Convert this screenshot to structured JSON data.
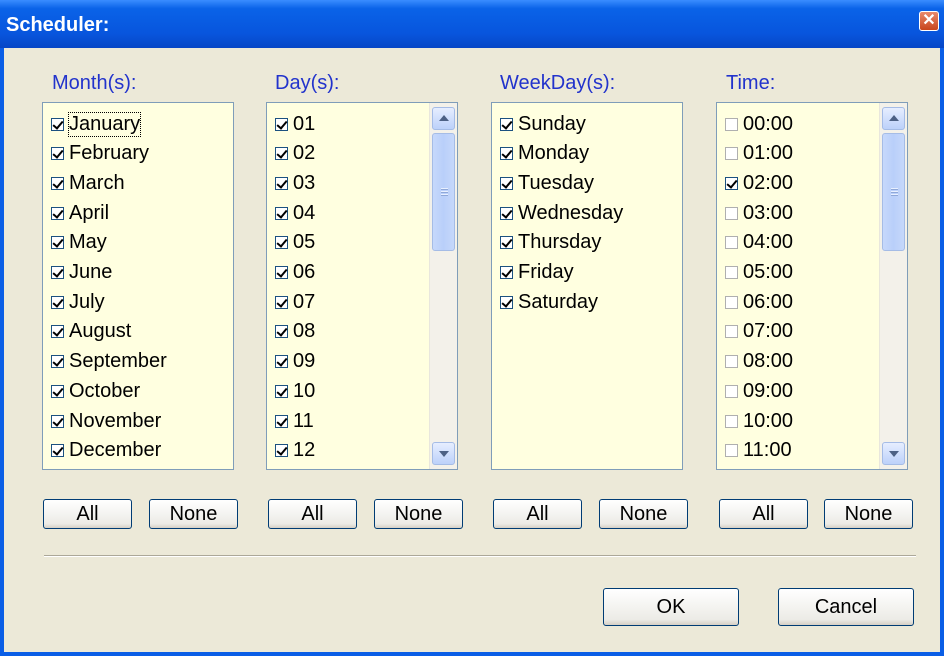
{
  "window": {
    "title": "Scheduler:",
    "close_glyph": "✕"
  },
  "groups": [
    {
      "label": "Month(s):",
      "items": [
        {
          "text": "January",
          "checked": true
        },
        {
          "text": "February",
          "checked": true
        },
        {
          "text": "March",
          "checked": true
        },
        {
          "text": "April",
          "checked": true
        },
        {
          "text": "May",
          "checked": true
        },
        {
          "text": "June",
          "checked": true
        },
        {
          "text": "July",
          "checked": true
        },
        {
          "text": "August",
          "checked": true
        },
        {
          "text": "September",
          "checked": true
        },
        {
          "text": "October",
          "checked": true
        },
        {
          "text": "November",
          "checked": true
        },
        {
          "text": "December",
          "checked": true
        }
      ],
      "all_label": "All",
      "none_label": "None"
    },
    {
      "label": "Day(s):",
      "items": [
        {
          "text": "01",
          "checked": true
        },
        {
          "text": "02",
          "checked": true
        },
        {
          "text": "03",
          "checked": true
        },
        {
          "text": "04",
          "checked": true
        },
        {
          "text": "05",
          "checked": true
        },
        {
          "text": "06",
          "checked": true
        },
        {
          "text": "07",
          "checked": true
        },
        {
          "text": "08",
          "checked": true
        },
        {
          "text": "09",
          "checked": true
        },
        {
          "text": "10",
          "checked": true
        },
        {
          "text": "11",
          "checked": true
        },
        {
          "text": "12",
          "checked": true
        }
      ],
      "all_label": "All",
      "none_label": "None"
    },
    {
      "label": "WeekDay(s):",
      "items": [
        {
          "text": "Sunday",
          "checked": true
        },
        {
          "text": "Monday",
          "checked": true
        },
        {
          "text": "Tuesday",
          "checked": true
        },
        {
          "text": "Wednesday",
          "checked": true
        },
        {
          "text": "Thursday",
          "checked": true
        },
        {
          "text": "Friday",
          "checked": true
        },
        {
          "text": "Saturday",
          "checked": true
        }
      ],
      "all_label": "All",
      "none_label": "None"
    },
    {
      "label": "Time:",
      "items": [
        {
          "text": "00:00",
          "checked": false
        },
        {
          "text": "01:00",
          "checked": false
        },
        {
          "text": "02:00",
          "checked": true
        },
        {
          "text": "03:00",
          "checked": false
        },
        {
          "text": "04:00",
          "checked": false
        },
        {
          "text": "05:00",
          "checked": false
        },
        {
          "text": "06:00",
          "checked": false
        },
        {
          "text": "07:00",
          "checked": false
        },
        {
          "text": "08:00",
          "checked": false
        },
        {
          "text": "09:00",
          "checked": false
        },
        {
          "text": "10:00",
          "checked": false
        },
        {
          "text": "11:00",
          "checked": false
        }
      ],
      "all_label": "All",
      "none_label": "None"
    }
  ],
  "footer": {
    "ok_label": "OK",
    "cancel_label": "Cancel"
  },
  "colors": {
    "title_bar": "#0A5EE6",
    "list_bg": "#FFFFE0",
    "label_text": "#2233CC",
    "dialog_bg": "#ECE9D8"
  }
}
